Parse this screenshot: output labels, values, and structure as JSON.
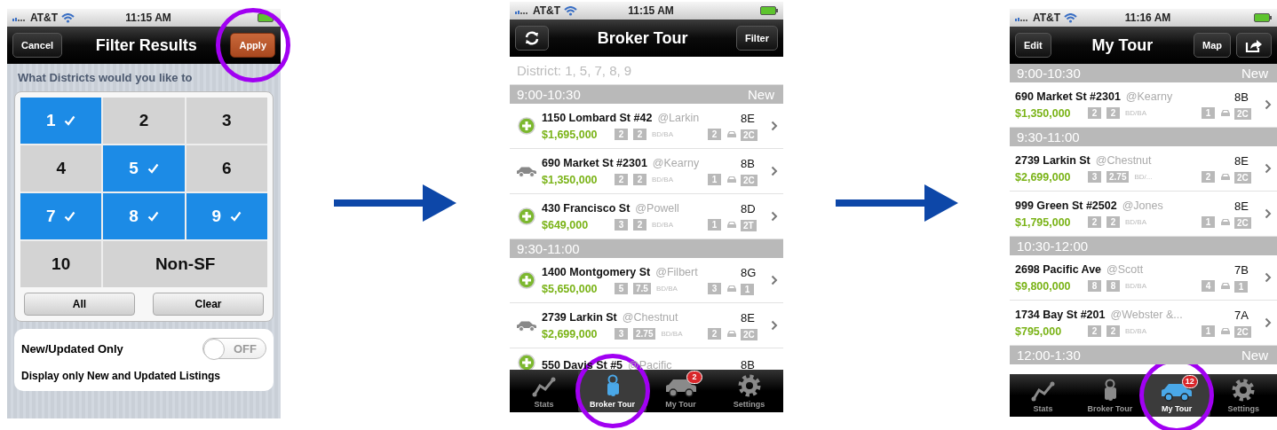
{
  "filter_screen": {
    "status_bar": {
      "carrier": "AT&T",
      "time": "11:15 AM"
    },
    "nav_bar": {
      "left": [
        {
          "kind": "text",
          "label": "Cancel",
          "accent": false
        }
      ],
      "title": "Filter Results",
      "right": [
        {
          "kind": "text",
          "label": "Apply",
          "accent": true,
          "circled": true
        }
      ]
    },
    "prompt": "What Districts would you like to",
    "districts": [
      {
        "kind": "single",
        "label": "1",
        "selected": true
      },
      {
        "kind": "single",
        "label": "2",
        "selected": false
      },
      {
        "kind": "single",
        "label": "3",
        "selected": false
      },
      {
        "kind": "single",
        "label": "4",
        "selected": false
      },
      {
        "kind": "single",
        "label": "5",
        "selected": true
      },
      {
        "kind": "single",
        "label": "6",
        "selected": false
      },
      {
        "kind": "single",
        "label": "7",
        "selected": true
      },
      {
        "kind": "single",
        "label": "8",
        "selected": true
      },
      {
        "kind": "single",
        "label": "9",
        "selected": true
      },
      {
        "kind": "single",
        "label": "10",
        "selected": false
      },
      {
        "kind": "wide",
        "label": "Non-SF",
        "selected": false
      }
    ],
    "actions": [
      "All",
      "Clear"
    ],
    "new_only": {
      "label": "New/Updated Only",
      "on": false,
      "state_label": "OFF"
    },
    "description": "Display only New and Updated Listings"
  },
  "broker_tour_screen": {
    "status_bar": {
      "carrier": "AT&T",
      "time": "11:15 AM"
    },
    "nav_bar": {
      "left": [
        {
          "kind": "refresh"
        }
      ],
      "title": "Broker Tour",
      "right": [
        {
          "kind": "text",
          "label": "Filter"
        }
      ]
    },
    "filter_summary": "District: 1, 5, 7, 8, 9",
    "list": [
      {
        "kind": "section",
        "label": "9:00-10:30",
        "tag": "New"
      },
      {
        "kind": "listing_add",
        "address": "1150 Lombard St #42",
        "cross_street": "@Larkin",
        "district": "8E",
        "price": "$1,695,000",
        "beds": "2",
        "baths": "2",
        "bdba": "BD/BA",
        "parking": "2",
        "type": "2C"
      },
      {
        "kind": "listing_car",
        "address": "690 Market St #2301",
        "cross_street": "@Kearny",
        "district": "8B",
        "price": "$1,350,000",
        "beds": "2",
        "baths": "2",
        "bdba": "BD/BA",
        "parking": "1",
        "type": "2C"
      },
      {
        "kind": "listing_add",
        "address": "430 Francisco St",
        "cross_street": "@Powell",
        "district": "8D",
        "price": "$649,000",
        "beds": "3",
        "baths": "2",
        "bdba": "BD/BA",
        "parking": "1",
        "type": "2T"
      },
      {
        "kind": "section",
        "label": "9:30-11:00"
      },
      {
        "kind": "listing_add",
        "address": "1400 Montgomery St",
        "cross_street": "@Filbert",
        "district": "8G",
        "price": "$5,650,000",
        "beds": "5",
        "baths": "7.5",
        "bdba": "BD/BA",
        "parking": "3",
        "type": "1"
      },
      {
        "kind": "listing_car",
        "address": "2739 Larkin St",
        "cross_street": "@Chestnut",
        "district": "8E",
        "price": "$2,699,000",
        "beds": "3",
        "baths": "2.75",
        "bdba": "BD/BA",
        "parking": "2",
        "type": "2C"
      },
      {
        "kind": "listing_partial_add",
        "address": "550 Davis St #5",
        "cross_street": "@Pacific",
        "district": "8B"
      }
    ],
    "tab_bar": [
      {
        "kind": "stats",
        "label": "Stats",
        "selected": false,
        "circled": false
      },
      {
        "kind": "keys",
        "label": "Broker Tour",
        "selected": true,
        "circled": true
      },
      {
        "kind": "car",
        "label": "My Tour",
        "selected": false,
        "circled": false,
        "badge": "2"
      },
      {
        "kind": "gear",
        "label": "Settings",
        "selected": false,
        "circled": false
      }
    ]
  },
  "my_tour_screen": {
    "status_bar": {
      "carrier": "AT&T",
      "time": "11:16 AM"
    },
    "nav_bar": {
      "left": [
        {
          "kind": "text",
          "label": "Edit"
        }
      ],
      "title": "My Tour",
      "right": [
        {
          "kind": "text",
          "label": "Map"
        },
        {
          "kind": "share"
        }
      ]
    },
    "list": [
      {
        "kind": "section",
        "label": "9:00-10:30",
        "tag": "New"
      },
      {
        "kind": "listing",
        "address": "690 Market St #2301",
        "cross_street": "@Kearny",
        "district": "8B",
        "price": "$1,350,000",
        "beds": "2",
        "baths": "2",
        "bdba": "BD/BA",
        "parking": "1",
        "type": "2C"
      },
      {
        "kind": "section",
        "label": "9:30-11:00"
      },
      {
        "kind": "listing",
        "address": "2739 Larkin St",
        "cross_street": "@Chestnut",
        "district": "8E",
        "price": "$2,699,000",
        "beds": "3",
        "baths": "2.75",
        "bdba": "BD/...",
        "parking": "2",
        "type": "2C"
      },
      {
        "kind": "listing",
        "address": "999 Green St #2502",
        "cross_street": "@Jones",
        "district": "8E",
        "price": "$1,795,000",
        "beds": "2",
        "baths": "2",
        "bdba": "BD/BA",
        "parking": "1",
        "type": "2C"
      },
      {
        "kind": "section",
        "label": "10:30-12:00"
      },
      {
        "kind": "listing",
        "address": "2698 Pacific Ave",
        "cross_street": "@Scott",
        "district": "7B",
        "price": "$9,800,000",
        "beds": "8",
        "baths": "8",
        "bdba": "BD/BA",
        "parking": "4",
        "type": "1"
      },
      {
        "kind": "listing",
        "address": "1734 Bay St #201",
        "cross_street": "@Webster &...",
        "district": "7A",
        "price": "$795,000",
        "beds": "2",
        "baths": "2",
        "bdba": "BD/BA",
        "parking": "1",
        "type": "2C"
      },
      {
        "kind": "section",
        "label": "12:00-1:30",
        "tag": "New"
      }
    ],
    "tab_bar": [
      {
        "kind": "stats",
        "label": "Stats",
        "selected": false,
        "circled": false
      },
      {
        "kind": "keys",
        "label": "Broker Tour",
        "selected": false,
        "circled": false
      },
      {
        "kind": "car",
        "label": "My Tour",
        "selected": true,
        "circled": true,
        "badge": "12"
      },
      {
        "kind": "gear",
        "label": "Settings",
        "selected": false,
        "circled": false
      }
    ]
  }
}
